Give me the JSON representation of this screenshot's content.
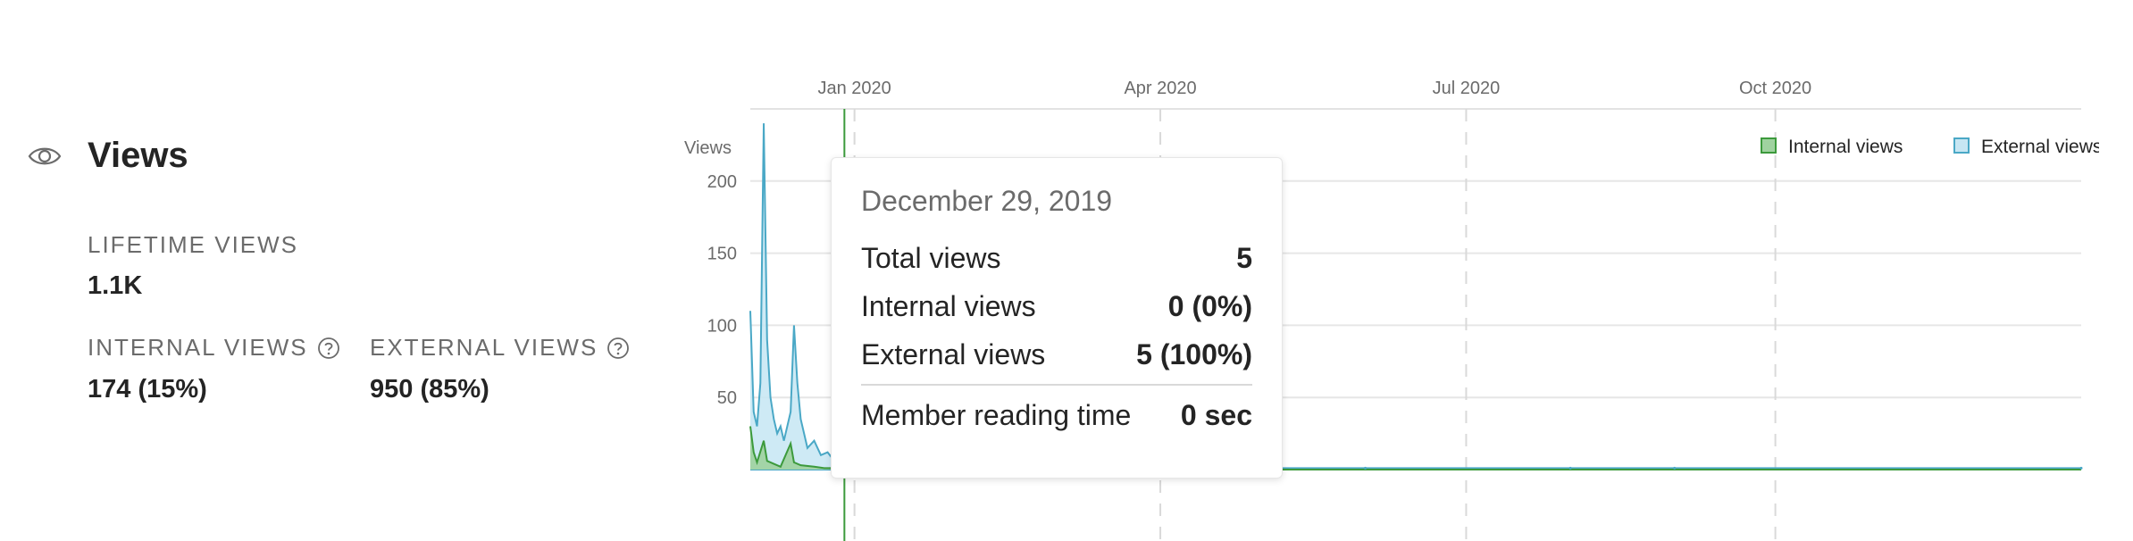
{
  "stats": {
    "title": "Views",
    "lifetime_label": "LIFETIME VIEWS",
    "lifetime_value": "1.1K",
    "internal_label": "INTERNAL VIEWS",
    "internal_value": "174 (15%)",
    "external_label": "EXTERNAL VIEWS",
    "external_value": "950 (85%)"
  },
  "icons": {
    "views": "eye-icon",
    "help": "question-circle-icon"
  },
  "colors": {
    "internal_fill": "#9fd29f",
    "internal_stroke": "#3c9a3c",
    "external_fill": "#c6e6f3",
    "external_stroke": "#4aa8c6",
    "cursor_line": "#3c9a3c"
  },
  "chart_data": {
    "type": "area",
    "ylabel": "Views",
    "x_ticks": [
      "Jan 2020",
      "Apr 2020",
      "Jul 2020",
      "Oct 2020"
    ],
    "y_ticks": [
      50,
      100,
      150,
      200
    ],
    "ylim": [
      0,
      250
    ],
    "grid": true,
    "legend_position": "top-right",
    "series": [
      {
        "name": "Internal views",
        "points": [
          [
            "2019-12-01",
            30
          ],
          [
            "2019-12-02",
            12
          ],
          [
            "2019-12-03",
            5
          ],
          [
            "2019-12-05",
            20
          ],
          [
            "2019-12-06",
            6
          ],
          [
            "2019-12-08",
            4
          ],
          [
            "2019-12-10",
            2
          ],
          [
            "2019-12-13",
            18
          ],
          [
            "2019-12-14",
            5
          ],
          [
            "2019-12-16",
            3
          ],
          [
            "2019-12-20",
            2
          ],
          [
            "2019-12-23",
            1
          ],
          [
            "2019-12-26",
            1
          ],
          [
            "2019-12-29",
            0
          ],
          [
            "2020-01-02",
            0
          ],
          [
            "2020-12-31",
            0
          ]
        ]
      },
      {
        "name": "External views",
        "points": [
          [
            "2019-12-01",
            110
          ],
          [
            "2019-12-02",
            40
          ],
          [
            "2019-12-03",
            30
          ],
          [
            "2019-12-04",
            60
          ],
          [
            "2019-12-05",
            240
          ],
          [
            "2019-12-06",
            90
          ],
          [
            "2019-12-07",
            50
          ],
          [
            "2019-12-08",
            35
          ],
          [
            "2019-12-09",
            25
          ],
          [
            "2019-12-10",
            30
          ],
          [
            "2019-12-11",
            20
          ],
          [
            "2019-12-13",
            40
          ],
          [
            "2019-12-14",
            100
          ],
          [
            "2019-12-15",
            60
          ],
          [
            "2019-12-16",
            35
          ],
          [
            "2019-12-17",
            25
          ],
          [
            "2019-12-18",
            15
          ],
          [
            "2019-12-20",
            20
          ],
          [
            "2019-12-22",
            10
          ],
          [
            "2019-12-24",
            12
          ],
          [
            "2019-12-26",
            6
          ],
          [
            "2019-12-28",
            4
          ],
          [
            "2019-12-29",
            5
          ],
          [
            "2020-01-01",
            3
          ],
          [
            "2020-01-03",
            10
          ],
          [
            "2020-01-05",
            4
          ],
          [
            "2020-01-08",
            2
          ],
          [
            "2020-01-20",
            1
          ],
          [
            "2020-02-10",
            0
          ],
          [
            "2020-05-01",
            1
          ],
          [
            "2020-06-01",
            1
          ],
          [
            "2020-08-01",
            1
          ],
          [
            "2020-09-01",
            1
          ],
          [
            "2020-12-31",
            1
          ]
        ]
      }
    ]
  },
  "tooltip": {
    "date": "December 29, 2019",
    "rows": [
      {
        "label": "Total views",
        "value": "5"
      },
      {
        "label": "Internal views",
        "value": "0 (0%)"
      },
      {
        "label": "External views",
        "value": "5 (100%)"
      }
    ],
    "reading_label": "Member reading time",
    "reading_value": "0 sec",
    "hover_date": "2019-12-29"
  }
}
